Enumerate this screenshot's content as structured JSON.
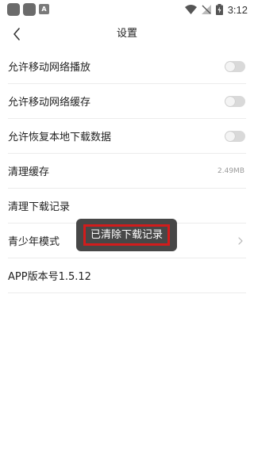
{
  "status_bar": {
    "time": "3:12",
    "notification_badge": "A"
  },
  "nav": {
    "title": "设置"
  },
  "settings": [
    {
      "label": "允许移动网络播放",
      "type": "toggle",
      "on": false
    },
    {
      "label": "允许移动网络缓存",
      "type": "toggle",
      "on": false
    },
    {
      "label": "允许恢复本地下载数据",
      "type": "toggle",
      "on": false
    },
    {
      "label": "清理缓存",
      "value": "2.49MB"
    },
    {
      "label": "清理下载记录"
    },
    {
      "label": "青少年模式",
      "has_chevron": true
    },
    {
      "label": "APP版本号1.5.12"
    }
  ],
  "toast": {
    "message": "已清除下载记录"
  },
  "colors": {
    "toast_bg": "#474747",
    "highlight_border": "#d21c1c",
    "toggle_off": "#d9d9d9"
  }
}
